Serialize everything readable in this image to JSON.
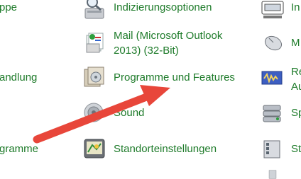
{
  "left_column": [
    {
      "label": "ppe"
    },
    {
      "label": "andlung"
    },
    {
      "label": "gramme"
    }
  ],
  "middle_column": [
    {
      "label": "Indizierungsoptionen",
      "icon": "indexing-options-icon"
    },
    {
      "label_line1": "Mail (Microsoft Outlook",
      "label_line2": "2013) (32-Bit)",
      "icon": "mail-icon"
    },
    {
      "label": "Programme und Features",
      "icon": "programs-features-icon"
    },
    {
      "label": "Sound",
      "icon": "sound-icon"
    },
    {
      "label": "Standorteinstellungen",
      "icon": "location-settings-icon"
    }
  ],
  "right_column": [
    {
      "label": "In",
      "icon": "keyboard-icon"
    },
    {
      "label": "M",
      "icon": "mouse-icon"
    },
    {
      "label_line1": "Re",
      "label_line2": "Au",
      "icon": "realtek-audio-icon"
    },
    {
      "label": "Sp",
      "icon": "storage-icon"
    },
    {
      "label": "St",
      "icon": "system-icon"
    }
  ],
  "colors": {
    "link": "#1e7b2a",
    "arrow": "#e8463a"
  }
}
